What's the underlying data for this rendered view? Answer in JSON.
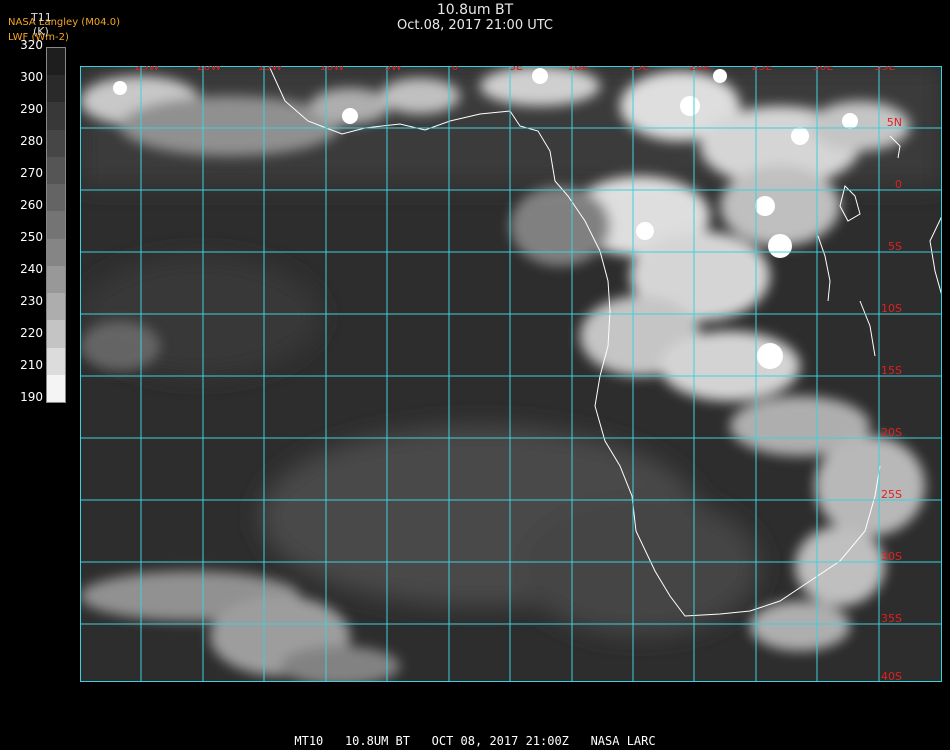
{
  "header": {
    "title": "10.8um BT",
    "subtitle": "Oct.08, 2017 21:00 UTC",
    "credit_line1": "NASA Langley (M04.0)",
    "credit_line2": "LWF (Wm-2)"
  },
  "colorbar": {
    "title": "T11",
    "unit": "(K)",
    "ticks": [
      "320",
      "300",
      "290",
      "280",
      "270",
      "260",
      "250",
      "240",
      "230",
      "220",
      "210",
      "190"
    ],
    "greys": [
      "#1e1e1e",
      "#2a2a2a",
      "#383838",
      "#464646",
      "#555555",
      "#646464",
      "#747474",
      "#858585",
      "#989898",
      "#adadad",
      "#c4c4c4",
      "#dcdcdc",
      "#f4f4f4"
    ]
  },
  "map": {
    "longitude_labels": [
      "25W",
      "20W",
      "15W",
      "10W",
      "5W",
      "0",
      "5E",
      "10E",
      "15E",
      "20E",
      "25E",
      "30E",
      "35E"
    ],
    "latitude_labels": [
      "5N",
      "0",
      "5S",
      "10S",
      "15S",
      "20S",
      "25S",
      "30S",
      "35S",
      "40S"
    ],
    "grid_color": "#3fd0e0",
    "label_color": "#e02020",
    "coast_color": "#ffffff"
  },
  "footer": {
    "text": "MT10   10.8UM BT   OCT 08, 2017 21:00Z   NASA LARC"
  }
}
